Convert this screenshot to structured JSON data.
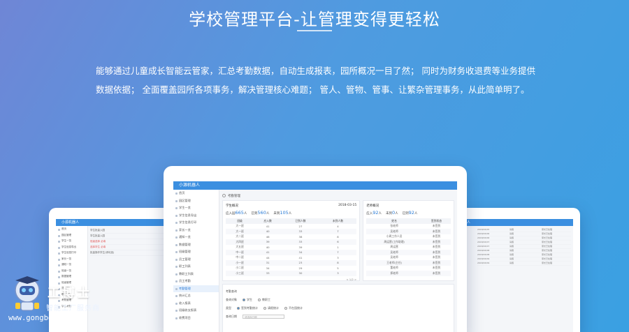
{
  "hero": {
    "title": "学校管理平台-让管理变得更轻松",
    "description": "能够通过儿童成长智能云管家，汇总考勤数据，自动生成报表，园所概况一目了然； 同时为财务收退费等业务提供数据依据； 全面覆盖园所各项事务，解决管理核心难题； 管人、管物、管事、让繁杂管理事务，从此简单明了。"
  },
  "app": {
    "header_title": "小源机器人",
    "breadcrumb": "考勤管理",
    "sidebar": [
      "首页",
      "园区管理",
      "学生一览",
      "学生信息导出",
      "学生信息打印",
      "家长一览",
      "通知一览",
      "数据管理",
      "班级管理",
      "员工管理",
      "职工列表",
      "教职工列表",
      "员工考勤",
      "考勤管理",
      "统计汇总",
      "收入报表",
      "班级收支报表",
      "收费项目"
    ],
    "active_sidebar_index": 13,
    "panel_a": {
      "title": "学生概况",
      "date": "2018-03-15",
      "stats": [
        {
          "label": "应入园",
          "value": "665",
          "unit": "人"
        },
        {
          "label": "已到",
          "value": "560",
          "unit": "人"
        },
        {
          "label": "未到",
          "value": "105",
          "unit": "人"
        }
      ],
      "columns": [
        "班级",
        "应入数",
        "已到人数",
        "未到人数"
      ],
      "rows": [
        [
          "大一班",
          "41",
          "27",
          "4"
        ],
        [
          "大一班",
          "40",
          "33",
          "7"
        ],
        [
          "大二班",
          "46",
          "38",
          "8"
        ],
        [
          "大四班",
          "39",
          "33",
          "6"
        ],
        [
          "大五班",
          "40",
          "39",
          "1"
        ],
        [
          "中一班",
          "41",
          "34",
          "7"
        ],
        [
          "中二班",
          "44",
          "41",
          "3"
        ],
        [
          "小一班",
          "31",
          "23",
          "8"
        ],
        [
          "小二班",
          "34",
          "29",
          "5"
        ],
        [
          "小三班",
          "33",
          "30",
          "3"
        ]
      ],
      "pager": "< 1/2 >"
    },
    "panel_b": {
      "title": "老师概况",
      "stats": [
        {
          "label": "应入",
          "value": "92",
          "unit": "人"
        },
        {
          "label": "未到",
          "value": "0",
          "unit": "人"
        },
        {
          "label": "已到",
          "value": "92",
          "unit": "人"
        }
      ],
      "columns": [
        "姓名",
        "签到状态"
      ],
      "rows": [
        [
          "张老师",
          "未签到"
        ],
        [
          "吴老师",
          "未签到"
        ],
        [
          "小周工作人员",
          "未签到"
        ],
        [
          "周运营(工作助理)",
          "未签到"
        ],
        [
          "周运营",
          "未签到"
        ],
        [
          "吴老师",
          "未签到"
        ],
        [
          "吴老师",
          "未签到"
        ],
        [
          "王老师(主任)",
          "未签到"
        ],
        [
          "董老师",
          "未签到"
        ],
        [
          "郑老师",
          "未签到"
        ]
      ]
    },
    "form": {
      "title": "考勤查询",
      "row1_label": "查询对象",
      "row1_options": [
        "学生",
        "教职工"
      ],
      "row2_label": "类型",
      "row2_options": [
        "签到考勤统计",
        "请假统计",
        "不在园统计"
      ],
      "row3_label": "查询日期",
      "row3_placeholder": "请选择日期"
    }
  },
  "left_device": {
    "header_title": "小源机器人",
    "crumb": "学生批量入园",
    "sidebar": [
      "首页",
      "园区管理",
      "学生一览",
      "学生信息导出",
      "学生信息打印",
      "家长一览",
      "通知一览",
      "班级一览",
      "数据管理",
      "班级管理",
      "员工管理",
      "职工列表",
      "考勤管理",
      "学生考勤"
    ],
    "lines": [
      "学生批量入园",
      "班级选择 必填",
      "选择学生 必填",
      "批量操作学生(请勾选)"
    ]
  },
  "right_device": {
    "header_title": "小源机器人",
    "rows": [
      [
        "2018/03/05",
        "请假",
        "家长已处理"
      ],
      [
        "2018/03/06",
        "请假",
        "家长已处理"
      ],
      [
        "2018/03/06",
        "请假",
        "家长已处理"
      ],
      [
        "2018/03/07",
        "请假",
        "家长已处理"
      ],
      [
        "2018/03/07",
        "请假",
        "家长已处理"
      ],
      [
        "2018/03/08",
        "请假",
        "家长已处理"
      ],
      [
        "2018/03/08",
        "请假",
        "家长已处理"
      ],
      [
        "2018/03/09",
        "请假",
        "家长已处理"
      ],
      [
        "2018/03/09",
        "请假",
        "家长已处理"
      ]
    ]
  },
  "watermark": {
    "brand": "工博士",
    "tagline": "智能工厂服务商",
    "url": "www.gongboshi.com"
  }
}
